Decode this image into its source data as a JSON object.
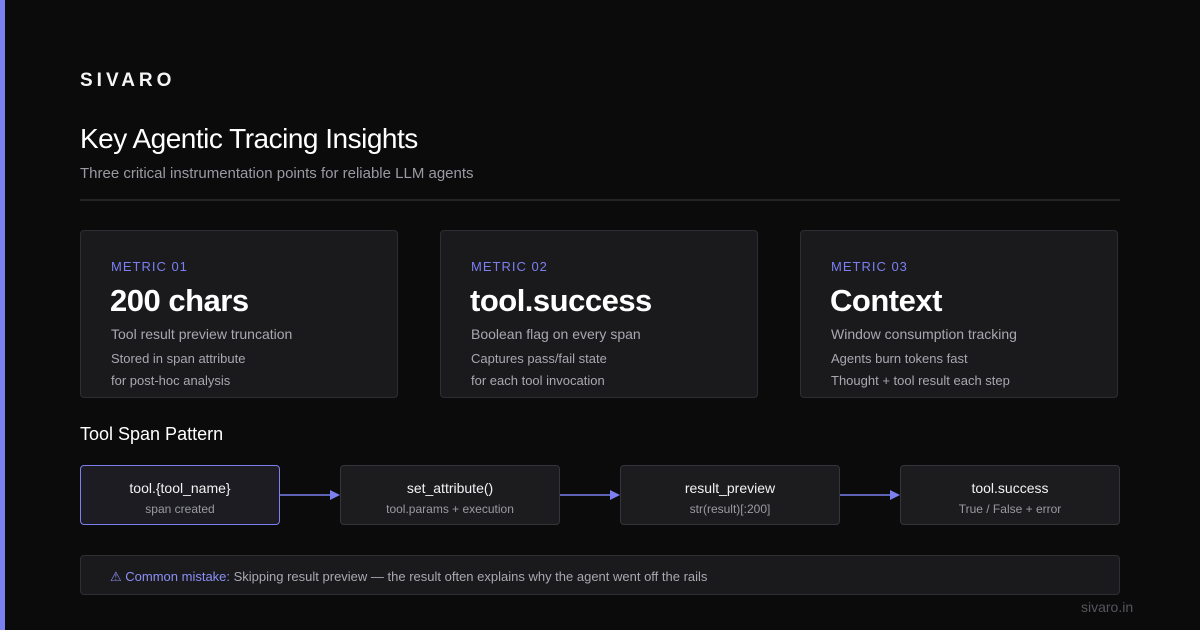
{
  "brand": "SIVARO",
  "header": {
    "title": "Key Agentic Tracing Insights",
    "subtitle": "Three critical instrumentation points for reliable LLM agents"
  },
  "metrics": [
    {
      "label": "METRIC 01",
      "value": "200 chars",
      "desc": "Tool result preview truncation",
      "note1": "Stored in span attribute",
      "note2": "for post-hoc analysis"
    },
    {
      "label": "METRIC 02",
      "value": "tool.success",
      "desc": "Boolean flag on every span",
      "note1": "Captures pass/fail state",
      "note2": "for each tool invocation"
    },
    {
      "label": "METRIC 03",
      "value": "Context",
      "desc": "Window consumption tracking",
      "note1": "Agents burn tokens fast",
      "note2": "Thought + tool result each step"
    }
  ],
  "pattern": {
    "title": "Tool Span Pattern",
    "steps": [
      {
        "name": "tool.{tool_name}",
        "sub": "span created"
      },
      {
        "name": "set_attribute()",
        "sub": "tool.params + execution"
      },
      {
        "name": "result_preview",
        "sub": "str(result)[:200]"
      },
      {
        "name": "tool.success",
        "sub": "True / False + error"
      }
    ]
  },
  "callout": {
    "prefix": "⚠ Common mistake:",
    "text": " Skipping result preview — the result often explains why the agent went off the rails"
  },
  "footer": "sivaro.in",
  "colors": {
    "accent": "#7b7ff0",
    "background": "#0b0b0c",
    "card": "#1a1a1d"
  }
}
